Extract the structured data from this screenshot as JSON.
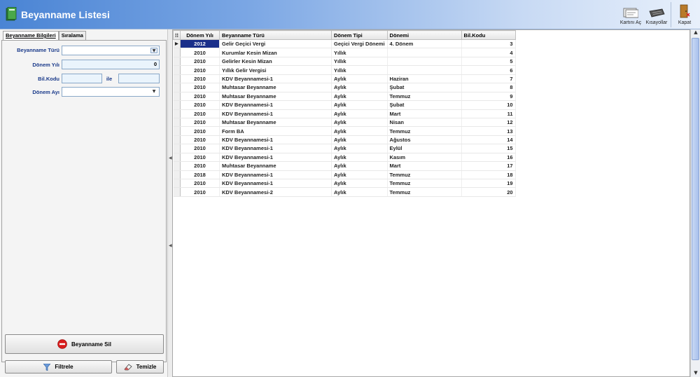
{
  "window": {
    "title": "Beyanname Listesi"
  },
  "toolbar": {
    "kart_label": "Kartını Aç",
    "kisayol_label": "Kısayollar",
    "kapat_label": "Kapat"
  },
  "filter_panel": {
    "tabs": [
      {
        "label": "Beyanname Bilgileri"
      },
      {
        "label": "Sıralama"
      }
    ],
    "fields": {
      "beyanname_turu_label": "Beyanname Türü",
      "donem_yili_label": "Dönem Yılı",
      "donem_yili_value": "0",
      "bil_kodu_label": "Bil.Kodu",
      "ile_label": "ile",
      "donem_ayi_label": "Dönem Ayı"
    },
    "buttons": {
      "delete_label": "Beyanname Sil",
      "filter_label": "Filtrele",
      "clear_label": "Temizle"
    }
  },
  "grid": {
    "columns": [
      "Dönem Yılı",
      "Beyanname Türü",
      "Dönem Tipi",
      "Dönemi",
      "Bil.Kodu"
    ],
    "rows": [
      [
        "2012",
        "Gelir Geçici Vergi",
        "Geçici Vergi Dönemi",
        "4. Dönem",
        "3"
      ],
      [
        "2010",
        "Kurumlar Kesin Mizan",
        "Yıllık",
        "",
        "4"
      ],
      [
        "2010",
        "Gelirler Kesin Mizan",
        "Yıllık",
        "",
        "5"
      ],
      [
        "2010",
        "Yıllık Gelir Vergisi",
        "Yıllık",
        "",
        "6"
      ],
      [
        "2010",
        "KDV Beyannamesi-1",
        "Aylık",
        "Haziran",
        "7"
      ],
      [
        "2010",
        "Muhtasar Beyanname",
        "Aylık",
        "Şubat",
        "8"
      ],
      [
        "2010",
        "Muhtasar Beyanname",
        "Aylık",
        "Temmuz",
        "9"
      ],
      [
        "2010",
        "KDV Beyannamesi-1",
        "Aylık",
        "Şubat",
        "10"
      ],
      [
        "2010",
        "KDV Beyannamesi-1",
        "Aylık",
        "Mart",
        "11"
      ],
      [
        "2010",
        "Muhtasar Beyanname",
        "Aylık",
        "Nisan",
        "12"
      ],
      [
        "2010",
        "Form BA",
        "Aylık",
        "Temmuz",
        "13"
      ],
      [
        "2010",
        "KDV Beyannamesi-1",
        "Aylık",
        "Ağustos",
        "14"
      ],
      [
        "2010",
        "KDV Beyannamesi-1",
        "Aylık",
        "Eylül",
        "15"
      ],
      [
        "2010",
        "KDV Beyannamesi-1",
        "Aylık",
        "Kasım",
        "16"
      ],
      [
        "2010",
        "Muhtasar Beyanname",
        "Aylık",
        "Mart",
        "17"
      ],
      [
        "2018",
        "KDV Beyannamesi-1",
        "Aylık",
        "Temmuz",
        "18"
      ],
      [
        "2010",
        "KDV Beyannamesi-1",
        "Aylık",
        "Temmuz",
        "19"
      ],
      [
        "2010",
        "KDV Beyannamesi-2",
        "Aylık",
        "Temmuz",
        "20"
      ]
    ]
  },
  "colors": {
    "header_blue": "#4a84d4",
    "label_blue": "#1a3a8a",
    "selection": "#1a2f8a",
    "delete_red": "#d81c1c"
  }
}
